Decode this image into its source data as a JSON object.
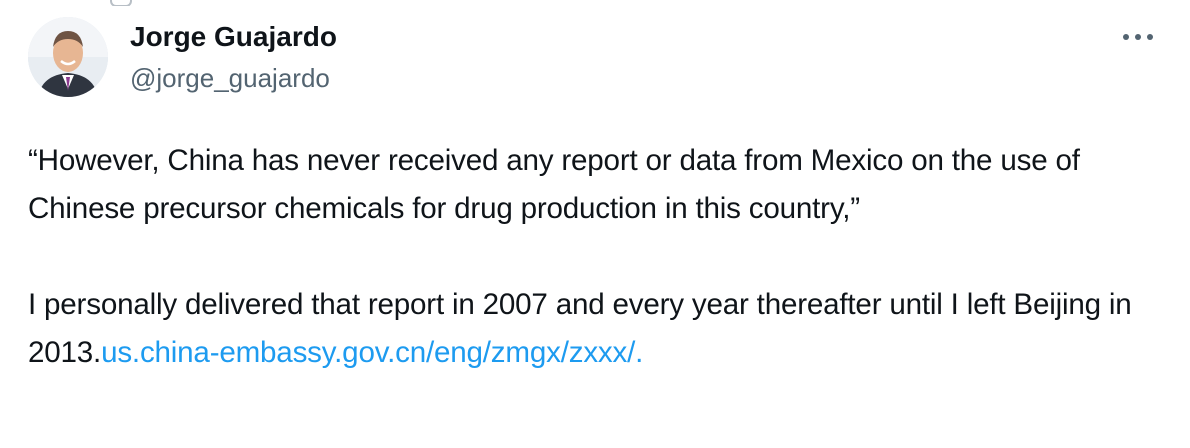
{
  "tweet": {
    "author": {
      "display_name": "Jorge Guajardo",
      "handle": "@jorge_guajardo",
      "avatar_icon": "profile-photo"
    },
    "more_icon": "more-options-icon",
    "text": {
      "quote": "“However, China has never received any report or data from Mexico on the use of Chinese precursor chemicals for drug production in this country,”",
      "statement": "I personally delivered that report in 2007 and every year thereafter until I left Beijing in 2013.",
      "link_text": "us.china-embassy.gov.cn/eng/zmgx/zxxx/."
    },
    "colors": {
      "text": "#0f1419",
      "secondary": "#536471",
      "link": "#1d9bf0"
    }
  }
}
